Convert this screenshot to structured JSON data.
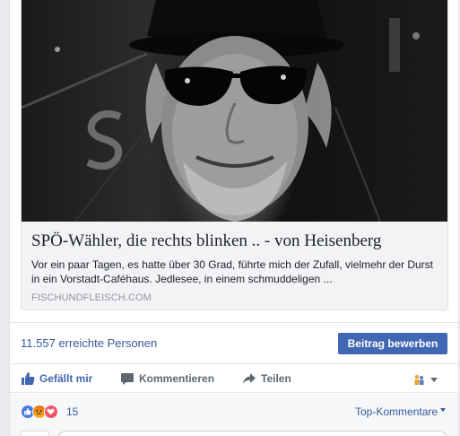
{
  "link_preview": {
    "image_alt": "Schwarzweißfoto eines Mannes mit Hut und Sonnenbrille",
    "title": "SPÖ-Wähler, die rechts blinken .. - von Heisenberg",
    "description": "Vor ein paar Tagen, es hatte über 30 Grad, führte mich der Zufall, vielmehr der Durst in ein Vorstadt-Caféhaus. Jedlesee, in einem schmuddeligen ...",
    "domain": "FISCHUNDFLEISCH.COM"
  },
  "insights": {
    "reach": "11.557 erreichte Personen",
    "promote_label": "Beitrag bewerben"
  },
  "actions": {
    "like_label": "Gefällt mir",
    "comment_label": "Kommentieren",
    "share_label": "Teilen"
  },
  "reactions": {
    "count": "15",
    "types": [
      "like",
      "angry",
      "love"
    ],
    "sort_label": "Top-Kommentare"
  },
  "colors": {
    "brand_blue": "#4267b2",
    "link_blue": "#365899",
    "text_gray": "#606770",
    "domain_gray": "#90949c"
  }
}
